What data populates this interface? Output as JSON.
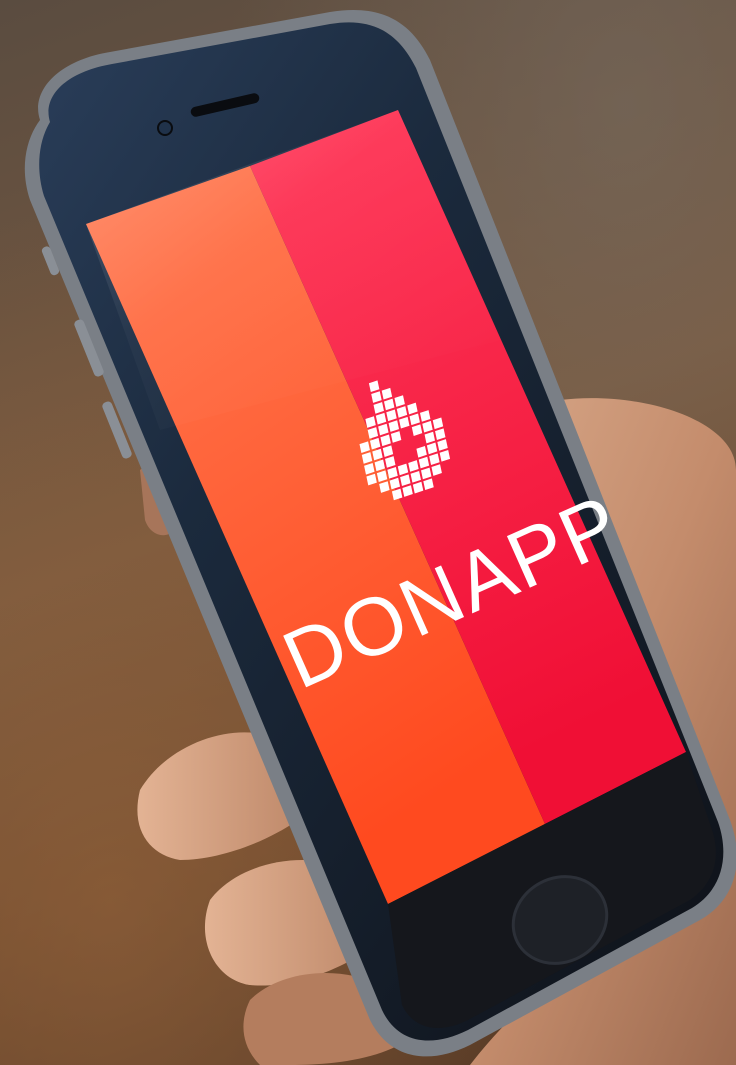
{
  "app": {
    "name": "DONAPP"
  },
  "colors": {
    "left_panel": "#ff5a2e",
    "right_panel": "#f4133a",
    "logo_white": "#ffffff",
    "phone_body": "#1a1c20",
    "phone_frame": "#6c7076"
  },
  "icons": {
    "logo": "pixel-blood-drop-icon"
  }
}
